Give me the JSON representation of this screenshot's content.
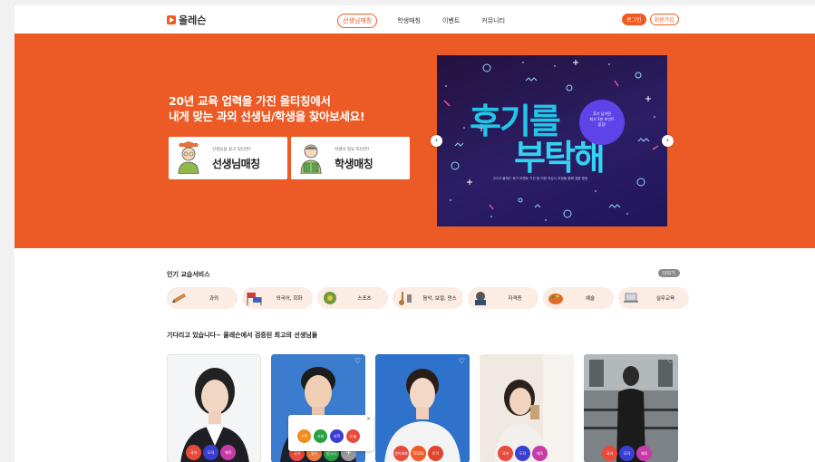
{
  "header": {
    "logo_text": "올레슨",
    "nav": [
      "선생님매칭",
      "학생매칭",
      "이벤트",
      "커뮤니티"
    ],
    "login_label": "로그인",
    "join_label": "회원가입"
  },
  "hero": {
    "title_line1": "20년 교육 업력을 가진 올티칭에서",
    "title_line2": "내게 맞는 과외 선생님/학생을 찾아보세요!",
    "card_teacher": {
      "sub": "선생님을 찾고 있다면?",
      "title": "선생님매칭"
    },
    "card_student": {
      "sub": "학생이 필요 하다면?",
      "title": "학생매칭"
    },
    "banner": {
      "line1": "후기를",
      "line2": "부탁해",
      "circle_text": [
        "후기 남기면",
        "최고 3만 포인트",
        "증정!"
      ],
      "small_text": "2023 올레슨 후기 이벤트 기간 중 리뷰 작성시 추첨을 통해 경품 증정"
    },
    "arrow_prev": "‹",
    "arrow_next": "›"
  },
  "popular": {
    "title": "인기 교습서비스",
    "more_label": "더보기",
    "categories": [
      {
        "label": "과외",
        "icon": "pencil-icon"
      },
      {
        "label": "외국어, 회화",
        "icon": "flags-icon"
      },
      {
        "label": "스포츠",
        "icon": "sports-icon"
      },
      {
        "label": "음악, 보컬, 댄스",
        "icon": "music-icon"
      },
      {
        "label": "자격증",
        "icon": "certificate-icon"
      },
      {
        "label": "예술",
        "icon": "art-icon"
      },
      {
        "label": "실무교육",
        "icon": "laptop-icon"
      }
    ]
  },
  "teachers": {
    "title": "기다리고 있습니다~ 올레슨에서 검증된 최고의 선생님들",
    "cards": [
      {
        "tags": [
          {
            "t": "국어",
            "c": "#e84a3c"
          },
          {
            "t": "도덕",
            "c": "#3a3fd1"
          },
          {
            "t": "체육",
            "c": "#c73ba8"
          }
        ]
      },
      {
        "tags": [
          {
            "t": "국어",
            "c": "#e84a3c"
          },
          {
            "t": "영어",
            "c": "#ef7a3b"
          },
          {
            "t": "한국사",
            "c": "#2aa043"
          },
          {
            "t": "+",
            "c": "#9a9a9a"
          }
        ]
      },
      {
        "tags": [
          {
            "t": "영어회화",
            "c": "#e84a3c"
          },
          {
            "t": "TESOL",
            "c": "#ef5a2b"
          },
          {
            "t": "토익",
            "c": "#e0452e"
          }
        ]
      },
      {
        "tags": [
          {
            "t": "국어",
            "c": "#e84a3c"
          },
          {
            "t": "도덕",
            "c": "#3a3fd1"
          },
          {
            "t": "체육",
            "c": "#c73ba8"
          }
        ]
      },
      {
        "tags": [
          {
            "t": "국어",
            "c": "#e84a3c"
          },
          {
            "t": "도덕",
            "c": "#3a3fd1"
          },
          {
            "t": "체육",
            "c": "#c73ba8"
          }
        ]
      }
    ],
    "popup_tags": [
      {
        "t": "수학",
        "c": "#f28c1b"
      },
      {
        "t": "사회",
        "c": "#2aa043"
      },
      {
        "t": "과학",
        "c": "#3a3fd1"
      },
      {
        "t": "논술",
        "c": "#e84a3c"
      }
    ],
    "popup_close": "×"
  },
  "colors": {
    "accent": "#ec5a25",
    "banner_bg": "#24123f",
    "banner_text": "#22c6e8"
  }
}
